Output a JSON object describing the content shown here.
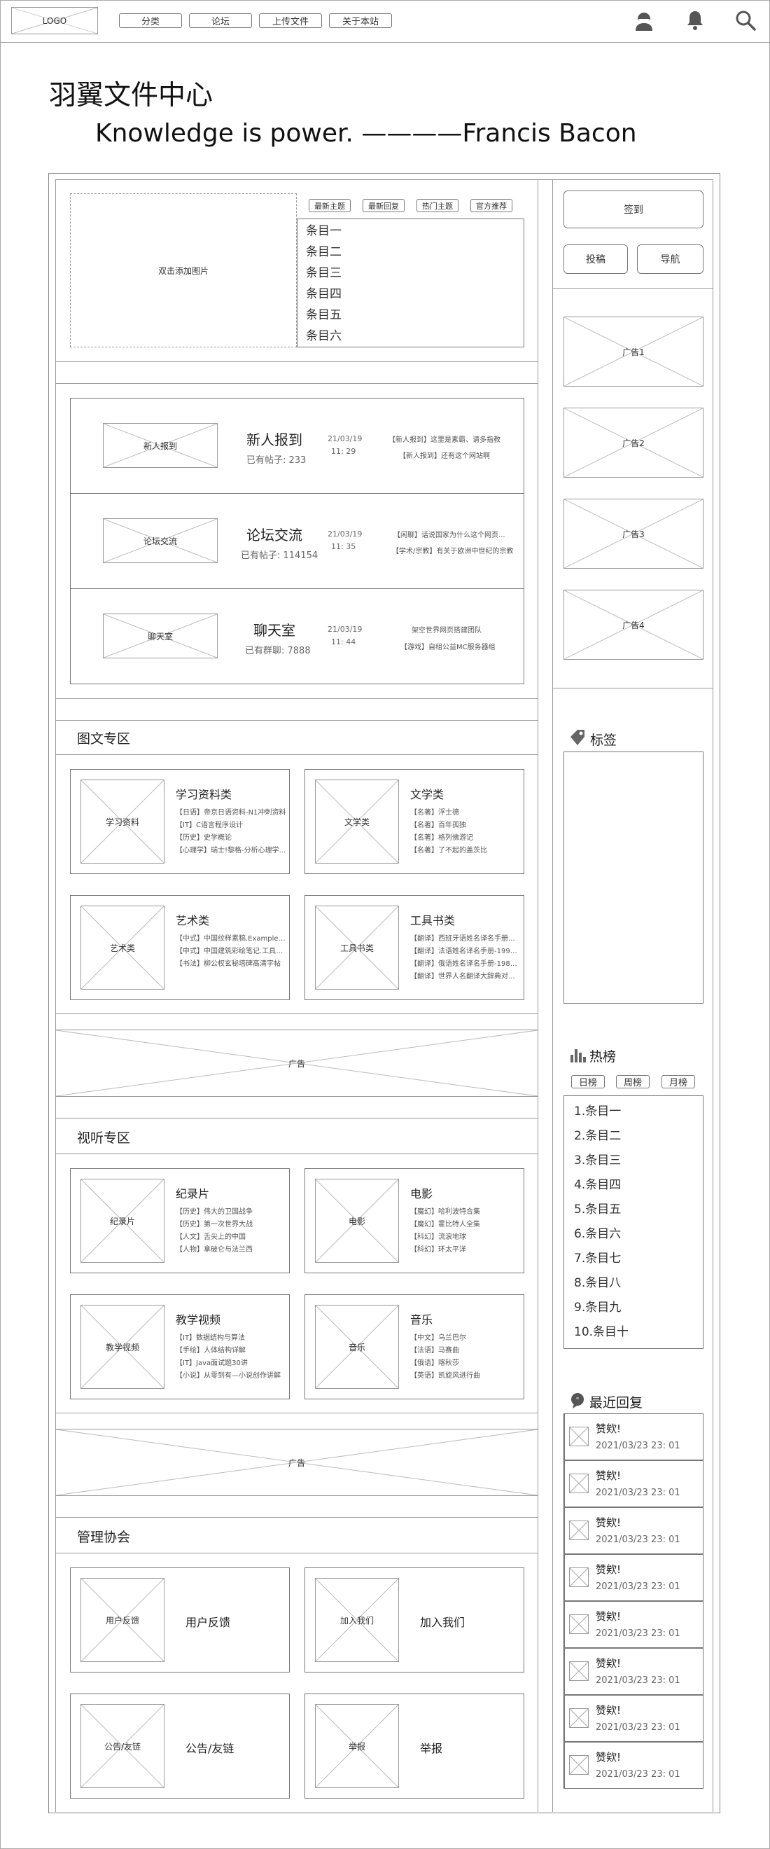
{
  "nav": {
    "logo": "LOGO",
    "items": [
      "分类",
      "论坛",
      "上传文件",
      "关于本站"
    ]
  },
  "site": {
    "title": "羽翼文件中心",
    "quote": "Knowledge is power. ————Francis Bacon"
  },
  "feature": {
    "image_label": "双击添加图片",
    "tabs": [
      "最新主题",
      "最新回复",
      "热门主题",
      "官方推荐"
    ],
    "items": [
      "条目一",
      "条目二",
      "条目三",
      "条目四",
      "条目五",
      "条目六"
    ]
  },
  "forums": [
    {
      "image_label": "新人报到",
      "name": "新人报到",
      "stat": "已有帖子: 233",
      "date": "21/03/19",
      "time": "11: 29",
      "posts": [
        "【新人报到】这里是素霸、请多指教",
        "【新人报到】还有这个网站啊"
      ]
    },
    {
      "image_label": "论坛交流",
      "name": "论坛交流",
      "stat": "已有帖子: 114154",
      "date": "21/03/19",
      "time": "11: 35",
      "posts": [
        "【闲聊】话说国家为什么这个网页...",
        "【学术/宗教】有关于欧洲中世纪的宗教"
      ]
    },
    {
      "image_label": "聊天室",
      "name": "聊天室",
      "stat": "已有群聊: 7888",
      "date": "21/03/19",
      "time": "11: 44",
      "posts": [
        "架空世界网页搭建团队",
        "【游戏】自组公益MC服务器组"
      ]
    }
  ],
  "graphic": {
    "title": "图文专区",
    "cards": [
      {
        "image_label": "学习资料",
        "title": "学习资料类",
        "items": [
          "【日语】帝京日语资料-N1冲刺资料",
          "【IT】C语言程序设计",
          "【历史】史学概论",
          "【心理学】瑞士!黎格-分析心理学..."
        ]
      },
      {
        "image_label": "文学类",
        "title": "文学类",
        "items": [
          "【名著】浮士德",
          "【名著】百年孤独",
          "【名著】格列佛游记",
          "【名著】了不起的盖茨比"
        ]
      },
      {
        "image_label": "艺术类",
        "title": "艺术类",
        "items": [
          "【中式】中国纹样素稿.Examples o...",
          "【中式】中国建筑彩绘笔记.工具与...",
          "【书法】柳公权玄秘塔碑高清字帖"
        ]
      },
      {
        "image_label": "工具书类",
        "title": "工具书类",
        "items": [
          "【翻译】西班牙语姓名译名手册...",
          "【翻译】法语姓名译名手册-1996...",
          "【翻译】俄语姓名译名手册-1982...",
          "【翻译】世界人名翻译大辞典对..."
        ]
      }
    ]
  },
  "ad_label": "广告",
  "media": {
    "title": "视听专区",
    "cards": [
      {
        "image_label": "纪录片",
        "title": "纪录片",
        "items": [
          "【历史】伟大的卫国战争",
          "【历史】第一次世界大战",
          "【人文】舌尖上的中国",
          "【人物】拿破仑与法兰西"
        ]
      },
      {
        "image_label": "电影",
        "title": "电影",
        "items": [
          "【魔幻】哈利波特合集",
          "【魔幻】霍比特人全集",
          "【科幻】流浪地球",
          "【科幻】环太平洋"
        ]
      },
      {
        "image_label": "教学视频",
        "title": "教学视频",
        "items": [
          "【IT】数据结构与算法",
          "【手绘】人体结构详解",
          "【IT】Java面试题30讲",
          "【小说】从零到有—小说创作讲解"
        ]
      },
      {
        "image_label": "音乐",
        "title": "音乐",
        "items": [
          "【中文】乌兰巴尔",
          "【法语】马赛曲",
          "【俄语】喀秋莎",
          "【英语】凯旋风进行曲"
        ]
      }
    ]
  },
  "admin": {
    "title": "管理协会",
    "cards": [
      {
        "image_label": "用户反馈",
        "title": "用户反馈"
      },
      {
        "image_label": "加入我们",
        "title": "加入我们"
      },
      {
        "image_label": "公告/友链",
        "title": "公告/友链"
      },
      {
        "image_label": "举报",
        "title": "举报"
      }
    ]
  },
  "side": {
    "checkin": "签到",
    "submit": "投稿",
    "guide": "导航",
    "ads": [
      "广告1",
      "广告2",
      "广告3",
      "广告4"
    ],
    "tags_title": "标签",
    "hot_title": "热榜",
    "hot_tabs": [
      "日榜",
      "周榜",
      "月榜"
    ],
    "hot_items": [
      "1.条目一",
      "2.条目二",
      "3.条目三",
      "4.条目四",
      "5.条目五",
      "6.条目六",
      "7.条目七",
      "8.条目八",
      "9.条目九",
      "10.条目十"
    ],
    "recent_title": "最近回复",
    "recent": [
      {
        "title": "赞欸!",
        "time": "2021/03/23  23: 01"
      },
      {
        "title": "赞欸!",
        "time": "2021/03/23  23: 01"
      },
      {
        "title": "赞欸!",
        "time": "2021/03/23  23: 01"
      },
      {
        "title": "赞欸!",
        "time": "2021/03/23  23: 01"
      },
      {
        "title": "赞欸!",
        "time": "2021/03/23  23: 01"
      },
      {
        "title": "赞欸!",
        "time": "2021/03/23  23: 01"
      },
      {
        "title": "赞欸!",
        "time": "2021/03/23  23: 01"
      },
      {
        "title": "赞欸!",
        "time": "2021/03/23  23: 01"
      }
    ]
  }
}
